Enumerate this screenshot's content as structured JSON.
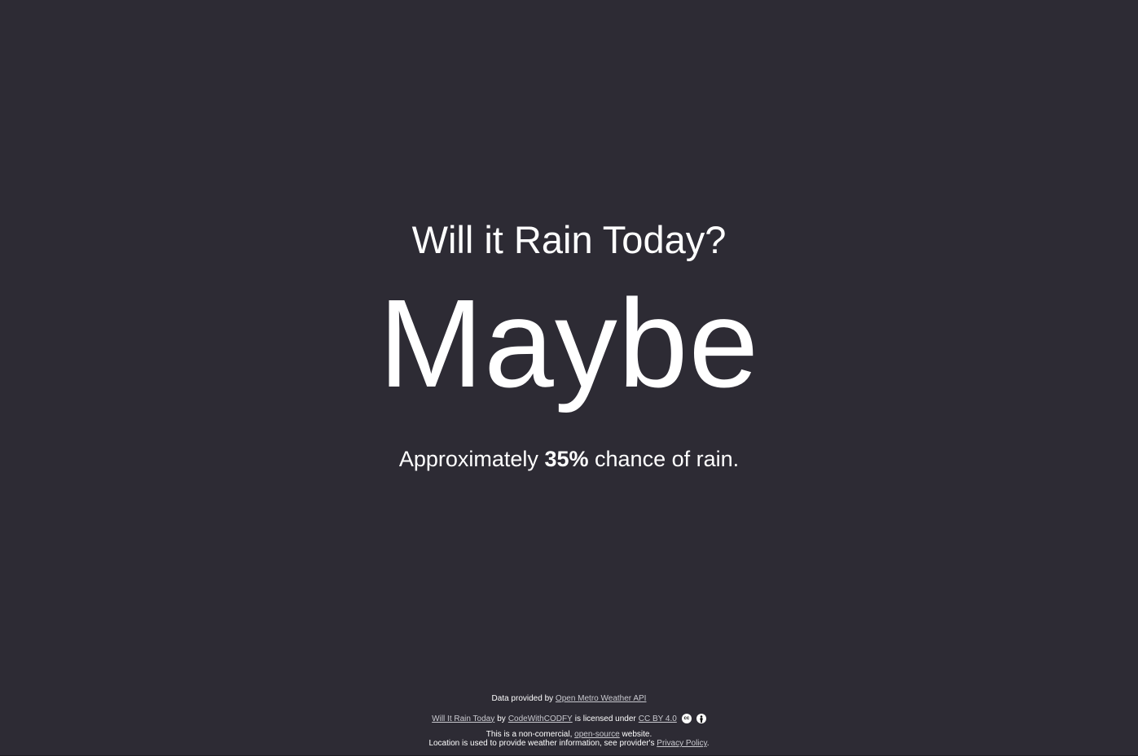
{
  "main": {
    "question": "Will it Rain Today?",
    "answer": "Maybe",
    "chance_prefix": "Approximately",
    "chance_value": "35%",
    "chance_suffix": "chance of rain."
  },
  "footer": {
    "data_prefix": "Data provided by",
    "data_link": "Open Metro Weather API",
    "site_link": "Will It Rain Today",
    "by_text": "by",
    "author_link": "CodeWithCODFY",
    "licensed_text": "is licensed under",
    "license_link": "CC BY 4.0",
    "cc_icon": "cc-icon",
    "by_icon": "by-icon",
    "noncommercial_prefix": "This is a non-comercial,",
    "opensource_link": "open-source",
    "noncommercial_suffix": "website.",
    "location_text": "Location is used to provide weather information, see provider's",
    "privacy_link": "Privacy Policy",
    "period": "."
  },
  "colors": {
    "background": "#2d2b34",
    "text": "#ffffff",
    "link": "#c9c9cf"
  }
}
